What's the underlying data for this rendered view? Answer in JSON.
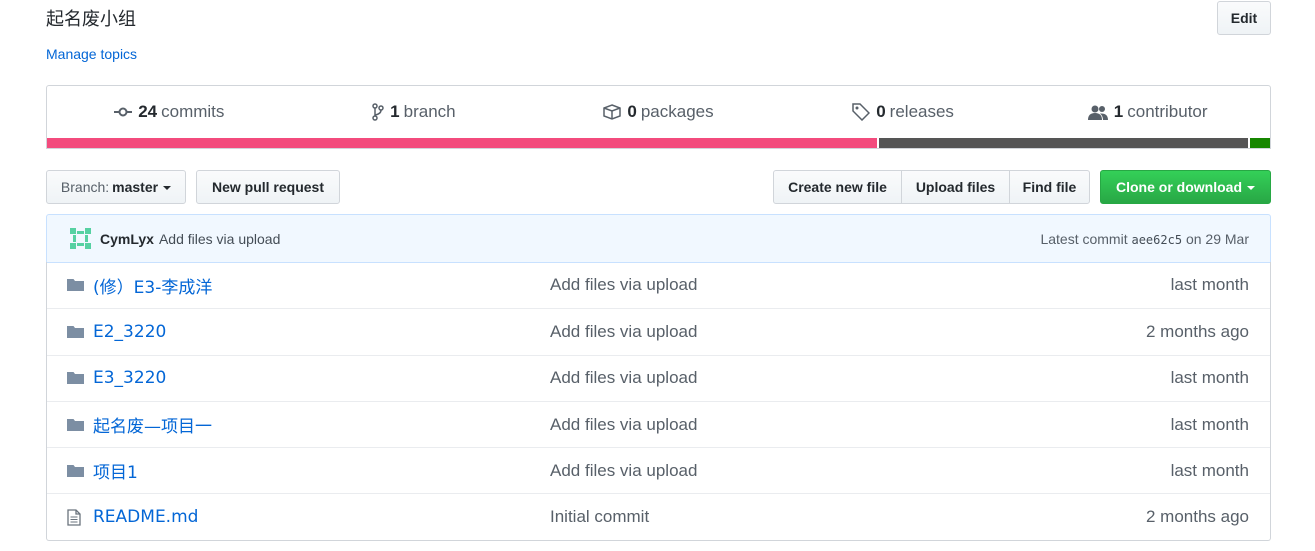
{
  "repo": {
    "description": "起名废小组",
    "edit_label": "Edit",
    "manage_topics": "Manage topics"
  },
  "stats": [
    {
      "icon": "commits-icon",
      "count": "24",
      "label": "commits"
    },
    {
      "icon": "branch-icon",
      "count": "1",
      "label": "branch"
    },
    {
      "icon": "package-icon",
      "count": "0",
      "label": "packages"
    },
    {
      "icon": "tag-icon",
      "count": "0",
      "label": "releases"
    },
    {
      "icon": "people-icon",
      "count": "1",
      "label": "contributor"
    }
  ],
  "language_bar": [
    {
      "color": "#f34b7d",
      "percent": 67.9
    },
    {
      "color": "#555555",
      "percent": 30.3
    },
    {
      "color": "#178600",
      "percent": 1.8
    }
  ],
  "toolbar": {
    "branch_label": "Branch:",
    "branch_value": "master",
    "new_pr": "New pull request",
    "create_file": "Create new file",
    "upload_files": "Upload files",
    "find_file": "Find file",
    "clone": "Clone or download"
  },
  "latest_commit": {
    "author": "CymLyx",
    "message": "Add files via upload",
    "prefix": "Latest commit",
    "sha": "aee62c5",
    "date": "on 29 Mar"
  },
  "files": [
    {
      "type": "dir",
      "name": "(修）E3-李成洋",
      "message": "Add files via upload",
      "age": "last month"
    },
    {
      "type": "dir",
      "name": "E2_3220",
      "message": "Add files via upload",
      "age": "2 months ago"
    },
    {
      "type": "dir",
      "name": "E3_3220",
      "message": "Add files via upload",
      "age": "last month"
    },
    {
      "type": "dir",
      "name": "起名废—项目一",
      "message": "Add files via upload",
      "age": "last month"
    },
    {
      "type": "dir",
      "name": "项目1",
      "message": "Add files via upload",
      "age": "last month"
    },
    {
      "type": "file",
      "name": "README.md",
      "message": "Initial commit",
      "age": "2 months ago"
    }
  ],
  "colors": {
    "link": "#0366d6",
    "clone_green": "#28a745",
    "commit_bg": "#f1f8ff"
  }
}
